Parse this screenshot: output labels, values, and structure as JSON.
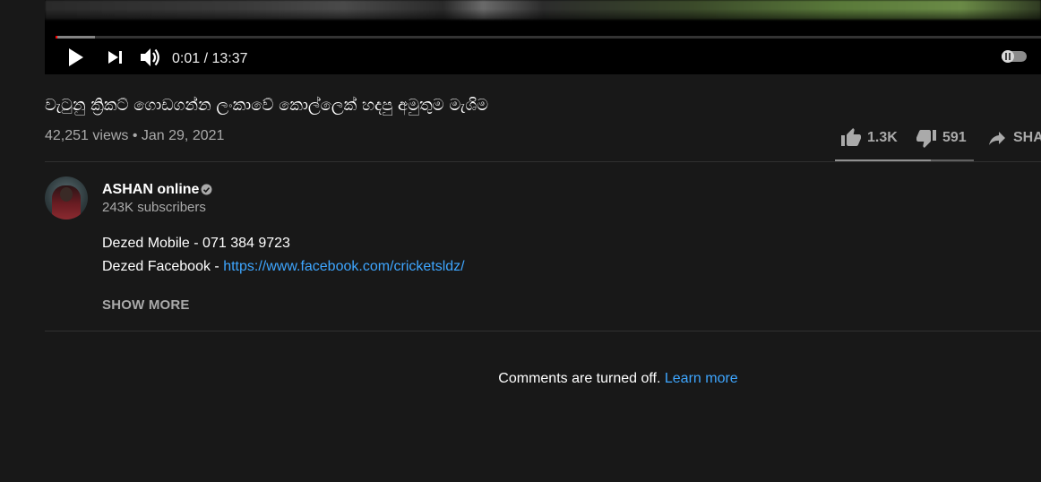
{
  "player": {
    "time_current": "0:01",
    "time_separator": " / ",
    "time_total": "13:37",
    "progress_played_fraction": 0.001,
    "progress_buffered_fraction": 0.04,
    "icons": {
      "play": "play-icon",
      "next": "next-icon",
      "volume": "volume-icon",
      "autoplay": "autoplay-toggle-icon"
    },
    "accent_color": "#ff0000"
  },
  "video": {
    "title": "වැටුනු ක්‍රිකට් ගොඩගන්න ලංකාවේ කොල්ලෙක් හදපු අමුතුම මැශිම",
    "views": "42,251 views",
    "separator": " • ",
    "date": "Jan 29, 2021"
  },
  "actions": {
    "like_count": "1.3K",
    "dislike_count": "591",
    "share_label": "SHA",
    "like_ratio": 0.69,
    "icons": {
      "like": "thumbs-up-icon",
      "dislike": "thumbs-down-icon",
      "share": "share-arrow-icon"
    }
  },
  "channel": {
    "name": "ASHAN online",
    "verified_icon": "verified-check-icon",
    "subscribers": "243K subscribers"
  },
  "description": {
    "line1_label": "Dezed Mobile - ",
    "line1_value": " 071 384 9723",
    "line2_label": "Dezed Facebook - ",
    "line2_link": "https://www.facebook.com/cricketsldz/",
    "show_more": "SHOW MORE",
    "link_color": "#3ea6ff"
  },
  "comments": {
    "message": "Comments are turned off.",
    "learn_more": "Learn more"
  }
}
